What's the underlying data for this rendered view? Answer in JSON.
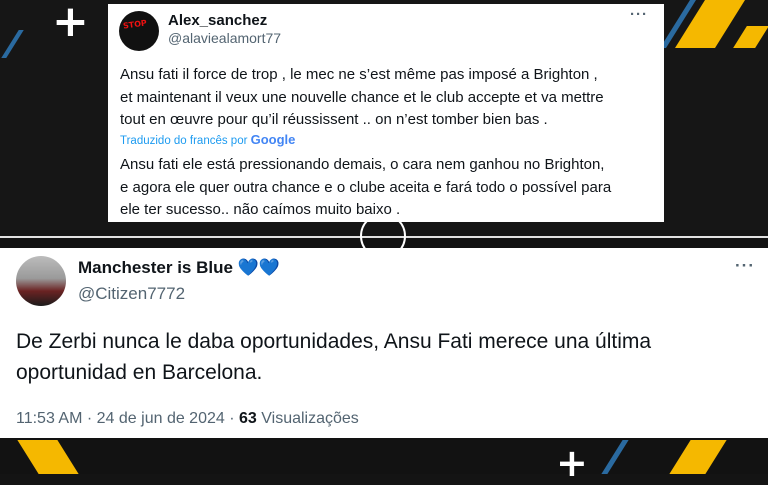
{
  "tweet1": {
    "avatar_text": "STOP",
    "name": "Alex_sanchez",
    "handle": "@alaviealamort77",
    "more": "···",
    "body_lines": [
      "Ansu fati il force de trop , le mec ne s’est même pas imposé a Brighton ,",
      "et maintenant il veux une nouvelle chance et le club accepte et va mettre",
      "tout en œuvre pour qu’il réussissent .. on n’est tomber bien bas ."
    ],
    "translation_label": "Traduzido do francês por",
    "translation_brand": "Google",
    "translated_lines": [
      "Ansu fati ele está pressionando demais, o cara nem ganhou no Brighton,",
      "e agora ele quer outra chance e o clube aceita e fará todo o possível para",
      "ele ter sucesso.. não caímos muito baixo ."
    ]
  },
  "tweet2": {
    "name": "Manchester is Blue",
    "hearts": "💙💙",
    "handle": "@Citizen7772",
    "more": "···",
    "body_lines": [
      "De Zerbi nunca le daba oportunidades, Ansu Fati merece una última",
      "oportunidad en Barcelona."
    ],
    "time": "11:53 AM",
    "date": "24 de jun de 2024",
    "separator": "·",
    "views_count": "63",
    "views_label": "Visualizações"
  },
  "decor": {
    "plus": "+",
    "accent_color": "#f5b800",
    "stripe_color": "#2a6aa0"
  }
}
